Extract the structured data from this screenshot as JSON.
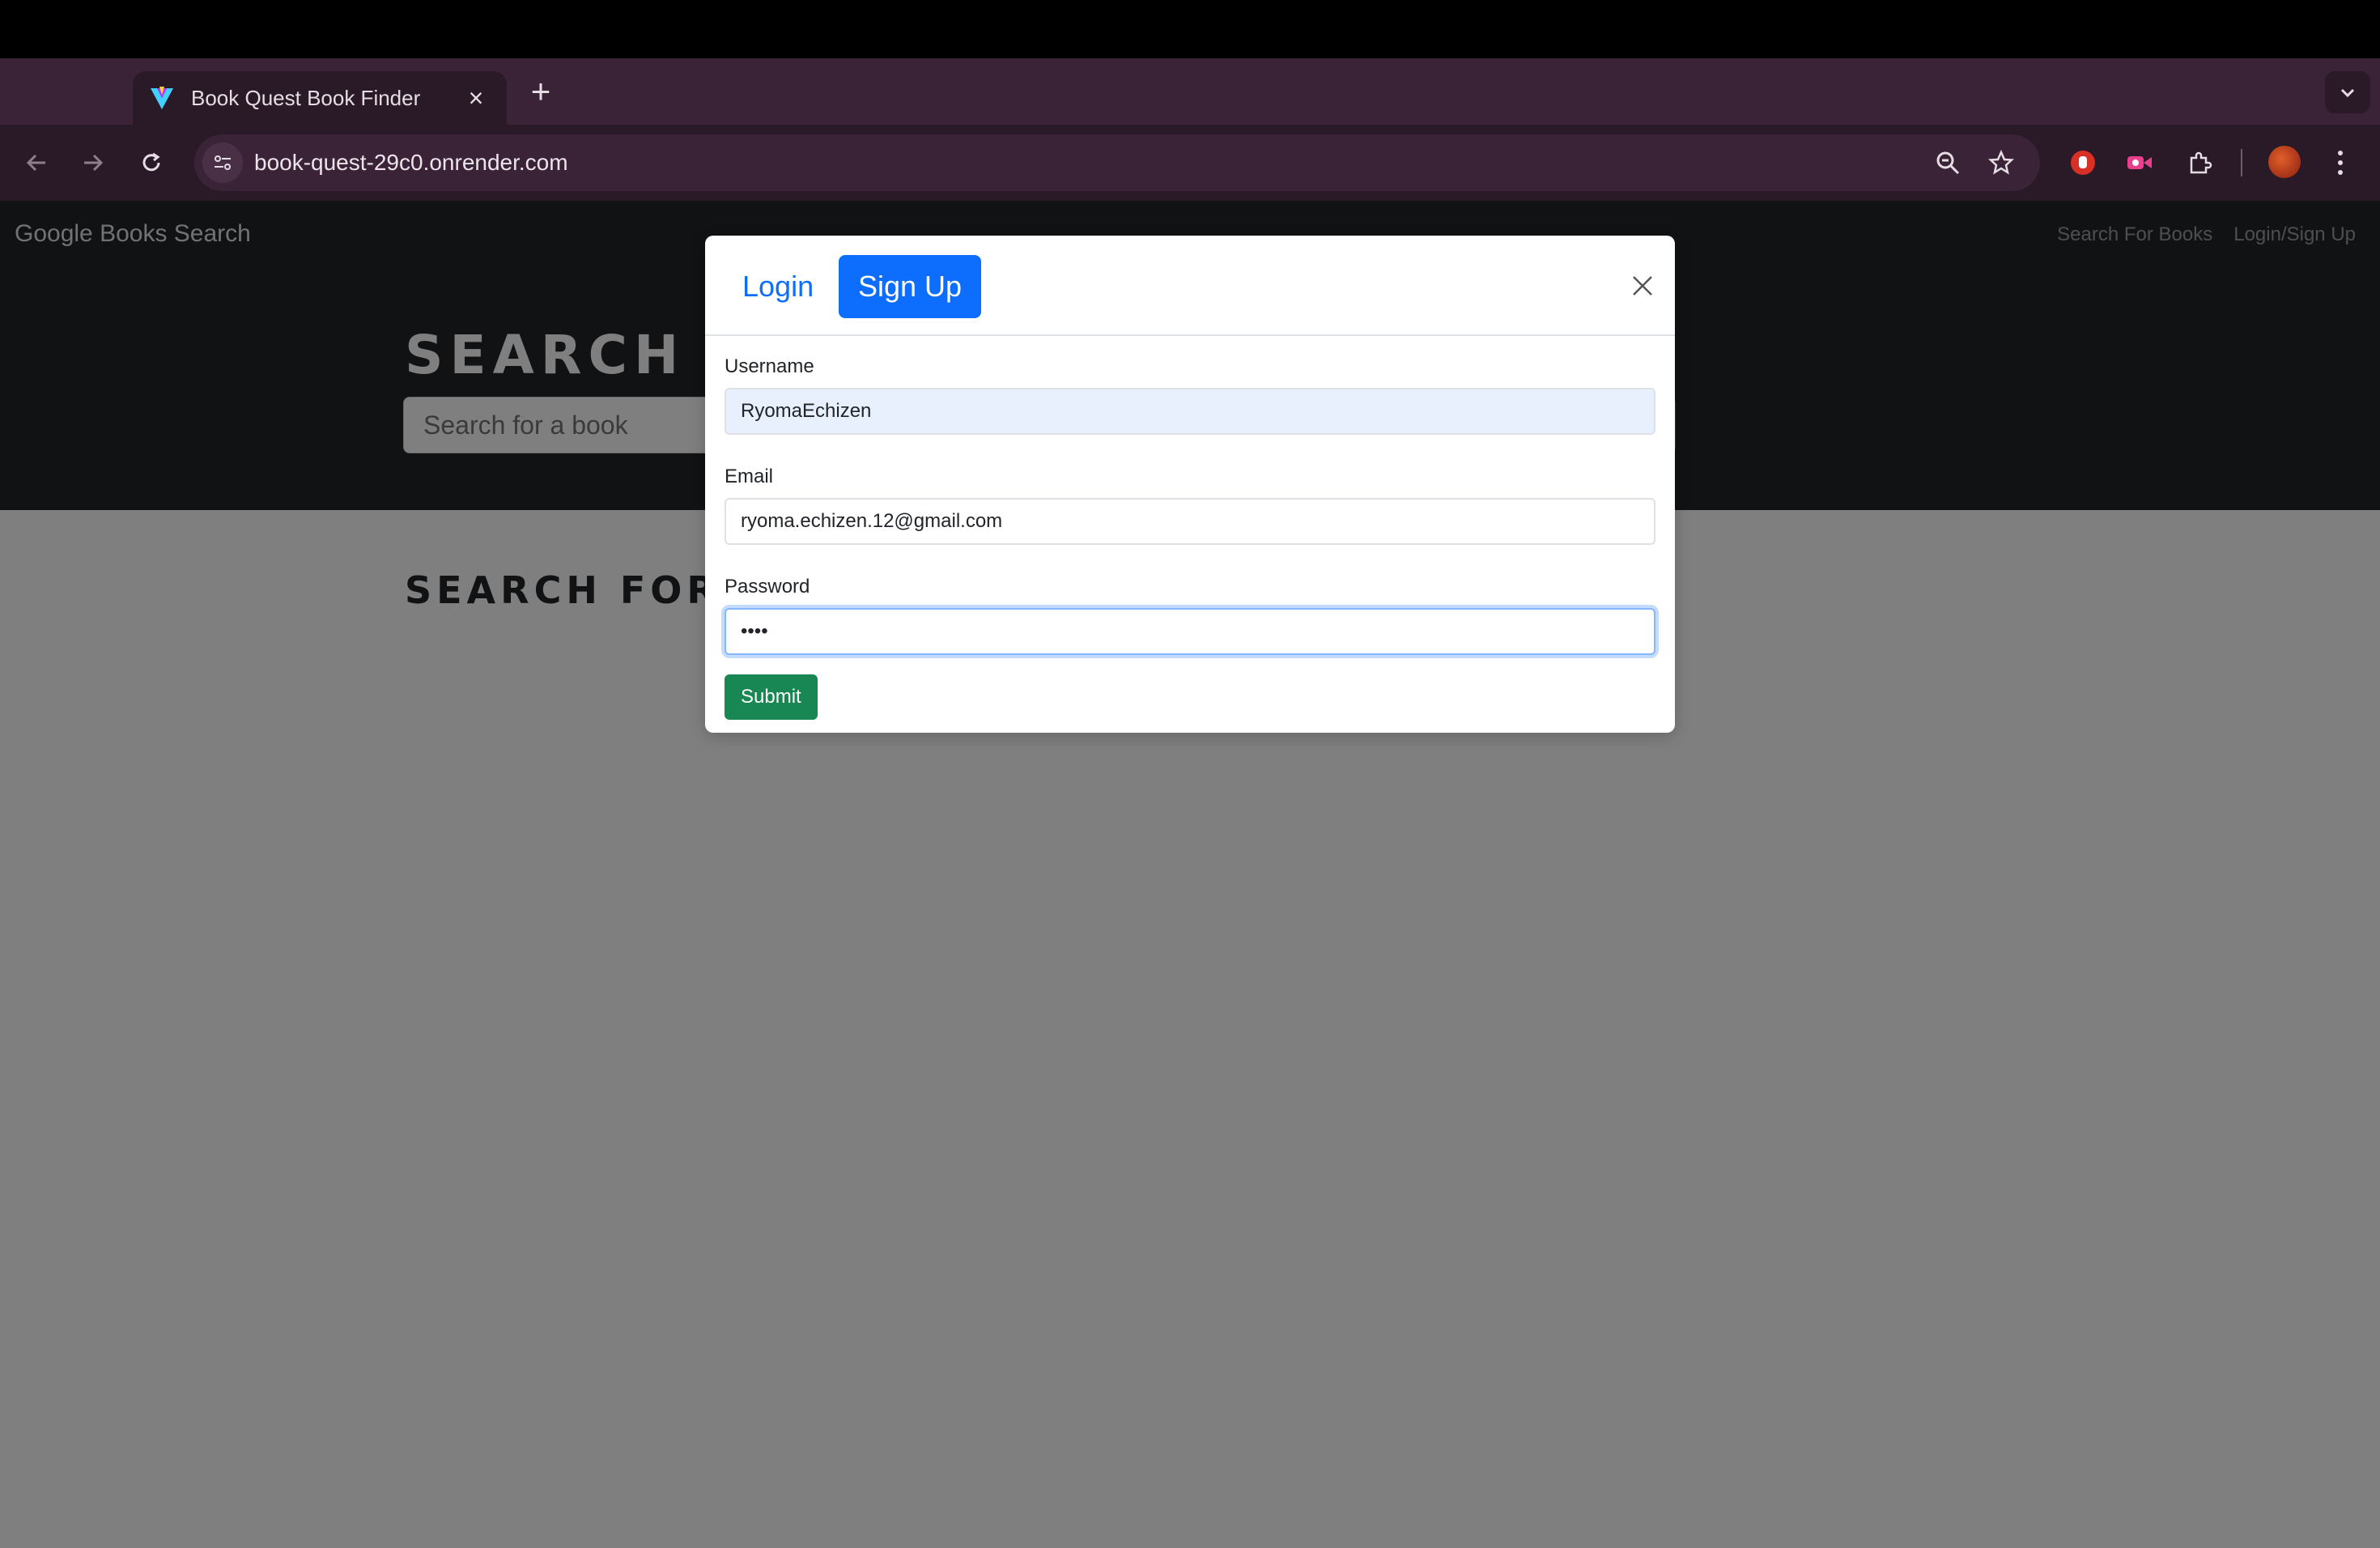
{
  "browser": {
    "tab_title": "Book Quest Book Finder",
    "url": "book-quest-29c0.onrender.com",
    "icons": [
      "favicon",
      "close-icon",
      "plus-icon",
      "chevron-down-icon",
      "back-icon",
      "forward-icon",
      "reload-icon",
      "site-settings-icon",
      "zoom-icon",
      "star-icon",
      "extension-icon",
      "profile-avatar",
      "kebab-menu-icon"
    ]
  },
  "navbar": {
    "brand": "Google Books Search",
    "links": [
      "Search For Books",
      "Login/Sign Up"
    ]
  },
  "hero": {
    "title": "SEARCH FOR BOOKS!",
    "search_placeholder": "Search for a book"
  },
  "results": {
    "title": "SEARCH FOR A BOOK TO BEGIN"
  },
  "modal": {
    "tabs": [
      "Login",
      "Sign Up"
    ],
    "active_tab": "Sign Up",
    "fields": {
      "username_label": "Username",
      "username_value": "RyomaEchizen",
      "email_label": "Email",
      "email_value": "ryoma.echizen.12@gmail.com",
      "password_label": "Password",
      "password_value": "••••"
    },
    "submit_label": "Submit"
  },
  "colors": {
    "primary": "#0d6efd",
    "success": "#198754",
    "dark": "#212529",
    "browser_frame": "#3a2337"
  }
}
